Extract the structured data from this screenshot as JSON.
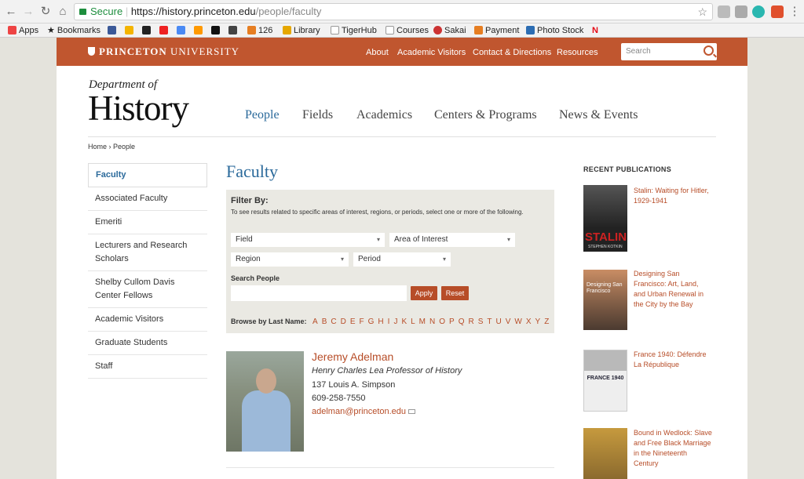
{
  "browser": {
    "back_icon": "arrow-left-icon",
    "forward_icon": "arrow-right-icon",
    "reload_icon": "reload-icon",
    "home_icon": "home-icon",
    "secure_label": "Secure",
    "url_scheme": "https://",
    "url_host": "history.princeton.edu",
    "url_path": "/people/faculty",
    "bookmarks": [
      "Apps",
      "Bookmarks",
      "126",
      "Library",
      "TigerHub",
      "Courses",
      "Sakai",
      "Payment",
      "Photo Stock"
    ]
  },
  "site": {
    "logo_bold": "PRINCETON",
    "logo_rest": " UNIVERSITY",
    "top_nav": [
      "About",
      "Academic Visitors",
      "Contact & Directions",
      "Resources"
    ],
    "search_placeholder": "Search",
    "dept_small": "Department of",
    "dept_big": "History",
    "main_nav": [
      "People",
      "Fields",
      "Academics",
      "Centers & Programs",
      "News & Events"
    ],
    "breadcrumb": "Home › People"
  },
  "sidebar": [
    "Faculty",
    "Associated Faculty",
    "Emeriti",
    "Lecturers and Research Scholars",
    "Shelby Cullom Davis Center Fellows",
    "Academic Visitors",
    "Graduate Students",
    "Staff"
  ],
  "main": {
    "heading": "Faculty",
    "filter_title": "Filter By:",
    "filter_desc": "To see results related to specific areas of interest, regions, or periods, select one or more of the following.",
    "selects": {
      "field": "Field",
      "area": "Area of Interest",
      "region": "Region",
      "period": "Period"
    },
    "search_label": "Search People",
    "apply": "Apply",
    "reset": "Reset",
    "browse_label": "Browse by Last Name:",
    "letters": [
      "A",
      "B",
      "C",
      "D",
      "E",
      "F",
      "G",
      "H",
      "I",
      "J",
      "K",
      "L",
      "M",
      "N",
      "O",
      "P",
      "Q",
      "R",
      "S",
      "T",
      "U",
      "V",
      "W",
      "X",
      "Y",
      "Z"
    ]
  },
  "person": {
    "name": "Jeremy Adelman",
    "title": "Henry Charles Lea Professor of History",
    "office": "137 Louis A. Simpson",
    "phone": "609-258-7550",
    "email": "adelman@princeton.edu"
  },
  "publications": {
    "title": "RECENT PUBLICATIONS",
    "items": [
      {
        "text": "Stalin: Waiting for Hitler, 1929-1941",
        "cover_title": "STALIN",
        "cover_author": "STEPHEN KOTKIN"
      },
      {
        "text": "Designing San Francisco: Art, Land, and Urban Renewal in the City by the Bay",
        "cover_title": "Designing San Francisco"
      },
      {
        "text": "France 1940: Défendre La République",
        "cover_title": "FRANCE 1940"
      },
      {
        "text": "Bound in Wedlock: Slave and Free Black Marriage in the Nineteenth Century",
        "cover_title": ""
      }
    ]
  },
  "colors": {
    "accent": "#c0562f",
    "link": "#b74d28",
    "nav_active": "#2b6a9b"
  }
}
